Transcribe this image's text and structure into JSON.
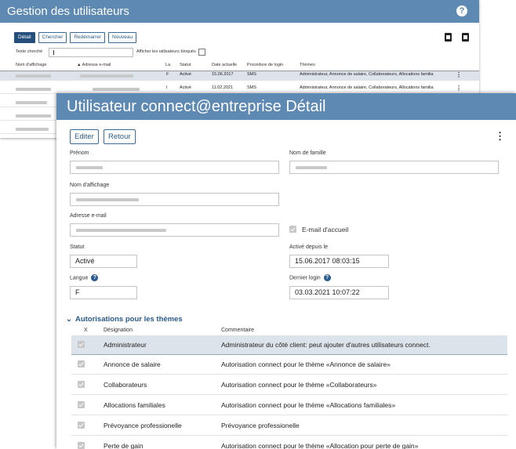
{
  "background_window": {
    "title": "Gestion des utilisateurs",
    "toolbar": {
      "detail": "Détail",
      "search": "Chercher",
      "restart": "Redémarrer",
      "new": "Nouveau"
    },
    "search_label": "Texte cherché",
    "show_blocked_label": "Afficher les utilisateurs bloqués",
    "columns": {
      "display_name": "Nom d'affichage",
      "email": "▲ Adresse e-mail",
      "lang": "La",
      "status": "Statut",
      "current_date": "Date actuelle",
      "login_proc": "Procédure de login",
      "themes": "Thèmes"
    },
    "rows": [
      {
        "lang": "F",
        "status": "Activé",
        "date": "15.06.2017",
        "proc": "SMS",
        "themes": "Administrateur, Annonce de salaire, Collaborateurs, Allocations familia"
      },
      {
        "lang": "I",
        "status": "Activé",
        "date": "11.02.2021",
        "proc": "SMS",
        "themes": "Administrateur, Annonce de salaire, Collaborateurs, Allocations familia"
      }
    ]
  },
  "detail_window": {
    "title": "Utilisateur connect@entreprise Détail",
    "buttons": {
      "edit": "Editer",
      "back": "Retour"
    },
    "fields": {
      "first_name_label": "Prénom",
      "last_name_label": "Nom de famille",
      "display_name_label": "Nom d'affichage",
      "email_label": "Adresse e-mail",
      "email_welcome_label": "E-mail d'accueil",
      "status_label": "Statut",
      "status_value": "Activé",
      "active_since_label": "Activé depuis le",
      "active_since_value": "15.06.2017 08:03:15",
      "language_label": "Langue",
      "language_value": "F",
      "last_login_label": "Dernier login",
      "last_login_value": "03.03.2021 10:07:22"
    },
    "authorizations": {
      "section_title": "Autorisations pour les thèmes",
      "col_x": "X",
      "col_designation": "Désignation",
      "col_comment": "Commentaire",
      "rows": [
        {
          "name": "Administrateur",
          "comment": "Administrateur du côté client: peut ajouter d'autres utilisateurs connect."
        },
        {
          "name": "Annonce de salaire",
          "comment": "Autorisation connect pour le thème «Annonce de salaire»"
        },
        {
          "name": "Collaborateurs",
          "comment": "Autorisation connect pour le thème «Collaborateurs»"
        },
        {
          "name": "Allocations familiales",
          "comment": "Autorisation connect pour le thème «Allocations familiales»"
        },
        {
          "name": "Prévoyance professionelle",
          "comment": "Prévoyance professionelle"
        },
        {
          "name": "Perte de gain",
          "comment": "Autorisation connect pour le thème «Allocation pour perte de gain»"
        }
      ]
    }
  },
  "colors": {
    "title_bar": "#5e89b3",
    "accent": "#2a5a8b",
    "selected_row": "#dde3ea"
  }
}
